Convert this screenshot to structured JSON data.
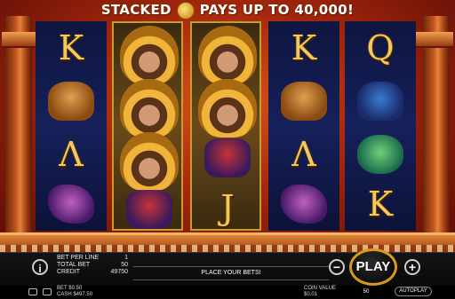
{
  "banner": {
    "left": "STACKED",
    "right": "PAYS UP TO 40,000!"
  },
  "reels": {
    "r1": [
      "K",
      "ram",
      "Λ",
      "bird"
    ],
    "r4": [
      "K",
      "ram",
      "Λ",
      "bird"
    ],
    "r5": [
      "Q",
      "bull",
      "fish",
      "K"
    ],
    "r3_letter": "J"
  },
  "panel": {
    "info_label": "i",
    "bet_per_line_label": "BET PER LINE",
    "bet_per_line_value": "1",
    "total_bet_label": "TOTAL BET",
    "total_bet_value": "50",
    "credit_label": "CREDIT",
    "credit_value": "49750",
    "message": "PLACE YOUR BETS!",
    "minus_label": "−",
    "plus_label": "+",
    "play_label": "PLAY",
    "bet_label": "BET $0.50",
    "cash_label": "CASH $497.50",
    "coin_value_label": "COIN VALUE",
    "coin_value": "$0.01",
    "coin_box_value": "50",
    "autoplay_label": "AUTOPLAY"
  }
}
